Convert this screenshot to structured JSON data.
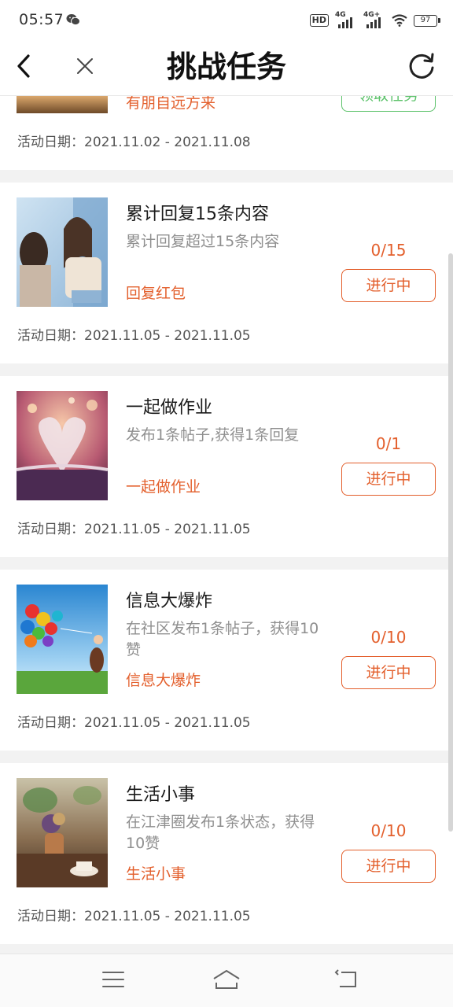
{
  "status_bar": {
    "time": "05:57",
    "wechat_icon": "wechat-icon",
    "hd_label": "HD",
    "net1_label": "4G",
    "net2_label": "4G+",
    "battery": "97"
  },
  "nav": {
    "title": "挑战任务",
    "back_icon": "back-arrow-icon",
    "close_icon": "close-icon",
    "refresh_icon": "refresh-icon"
  },
  "partial_task": {
    "tag": "有朋自远方来",
    "button": "领取任务",
    "date": "活动日期：2021.11.02 - 2021.11.08"
  },
  "tasks": [
    {
      "title": "累计回复15条内容",
      "desc": "累计回复超过15条内容",
      "tag": "回复红包",
      "progress": "0/15",
      "button": "进行中",
      "date": "活动日期：2021.11.05 - 2021.11.05"
    },
    {
      "title": "一起做作业",
      "desc": "发布1条帖子,获得1条回复",
      "tag": "一起做作业",
      "progress": "0/1",
      "button": "进行中",
      "date": "活动日期：2021.11.05 - 2021.11.05"
    },
    {
      "title": "信息大爆炸",
      "desc": "在社区发布1条帖子，获得10赞",
      "tag": "信息大爆炸",
      "progress": "0/10",
      "button": "进行中",
      "date": "活动日期：2021.11.05 - 2021.11.05"
    },
    {
      "title": "生活小事",
      "desc": "在江津圈发布1条状态，获得10赞",
      "tag": "生活小事",
      "progress": "0/10",
      "button": "进行中",
      "date": "活动日期：2021.11.05 - 2021.11.05"
    }
  ],
  "colors": {
    "accent": "#e35f2c",
    "green": "#5cc26a",
    "background": "#f2f2f2"
  },
  "bottom_nav": {
    "menu_icon": "menu-icon",
    "home_icon": "home-icon",
    "back_icon": "system-back-icon"
  }
}
